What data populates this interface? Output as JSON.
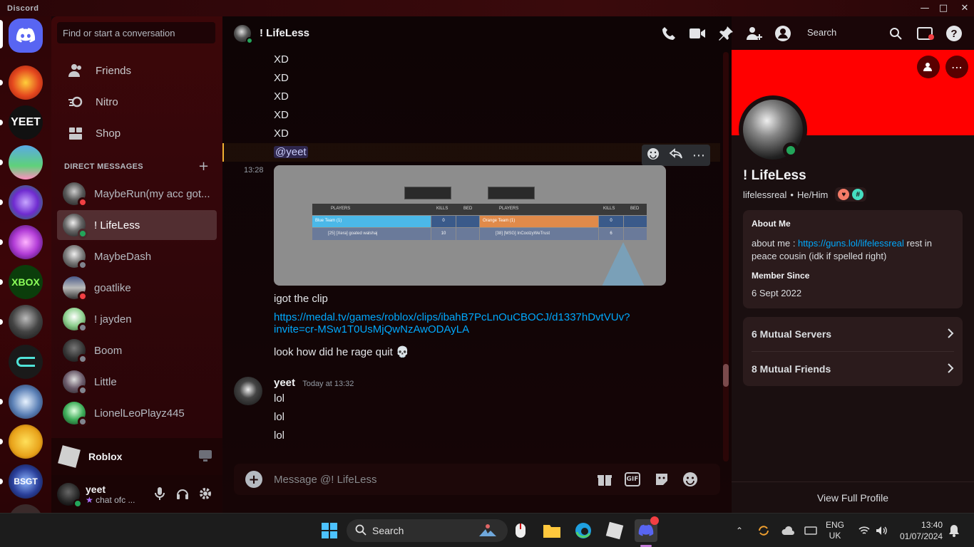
{
  "app": {
    "title": "Discord"
  },
  "dm_sidebar": {
    "search_placeholder": "Find or start a conversation",
    "nav": [
      {
        "label": "Friends",
        "icon": "friends-icon"
      },
      {
        "label": "Nitro",
        "icon": "nitro-icon"
      },
      {
        "label": "Shop",
        "icon": "shop-icon"
      }
    ],
    "section_title": "DIRECT MESSAGES",
    "dms": [
      {
        "name": "MaybeRun(my acc got...",
        "status": "dnd"
      },
      {
        "name": "! LifeLess",
        "status": "online"
      },
      {
        "name": "MaybeDash",
        "status": "offline"
      },
      {
        "name": "goatlike",
        "status": "dnd"
      },
      {
        "name": "! jayden",
        "status": "offline"
      },
      {
        "name": "Boom",
        "status": "offline"
      },
      {
        "name": "Little",
        "status": "offline"
      },
      {
        "name": "LionelLeoPlayz445",
        "status": "offline"
      }
    ],
    "activity": {
      "title": "Roblox"
    },
    "user": {
      "name": "yeet",
      "custom_status": "chat ofc ..."
    }
  },
  "chat": {
    "header_name": "! LifeLess",
    "search_label": "Search",
    "messages_top": [
      "XD",
      "XD",
      "XD",
      "XD",
      "XD"
    ],
    "mention": "@yeet",
    "attachment_time": "13:28",
    "scoreboard": {
      "team_left": "Blue Team (1)",
      "team_right": "Orange Team (1)",
      "players_header": "PLAYERS",
      "kills_header": "KILLS",
      "bed_header": "BED",
      "left_kills": "0",
      "right_kills": "0",
      "left_player": "[25] [Xera] goated walshaj",
      "left_player_kills": "10",
      "right_player": "[38] [MSG] InCoolzyWeTrust",
      "right_player_kills": "6"
    },
    "clip_text": "igot the clip",
    "clip_link": "https://medal.tv/games/roblox/clips/ibahB7PcLnOuCBOCJ/d1337hDvtVUv?invite=cr-MSw1T0UsMjQwNzAwODAyLA",
    "clip_link_line1": "https://medal.tv/games/roblox/clips/ibahB7PcLnOuCBOCJ/d1337hDvtVUv?",
    "clip_link_line2": "invite=cr-MSw1T0UsMjQwNzAwODAyLA",
    "rage_text": "look how did he rage quit",
    "rage_emoji": "💀",
    "yeet_author": "yeet",
    "yeet_time": "Today at 13:32",
    "yeet_lines": [
      "lol",
      "lol",
      "lol"
    ],
    "composer_placeholder": "Message @! LifeLess",
    "gif_label": "GIF"
  },
  "profile": {
    "display_name": "! LifeLess",
    "username": "lifelessreal",
    "pronouns": "He/Him",
    "about_title": "About Me",
    "about_prefix": "about me : ",
    "about_link": "https://guns.lol/lifelessreal",
    "about_suffix": " rest in peace cousin (idk if spelled right)",
    "member_since_title": "Member Since",
    "member_since": "6 Sept 2022",
    "mutual_servers": "6 Mutual Servers",
    "mutual_friends": "8 Mutual Friends",
    "view_full": "View Full Profile",
    "banner_color": "#ff0000"
  },
  "taskbar": {
    "search": "Search",
    "lang": "ENG",
    "region": "UK",
    "time": "13:40",
    "date": "01/07/2024"
  },
  "colors": {
    "online": "#23a55a",
    "dnd": "#f23f43",
    "offline": "#80848e",
    "link": "#00a8fc",
    "accent": "#5865f2"
  }
}
